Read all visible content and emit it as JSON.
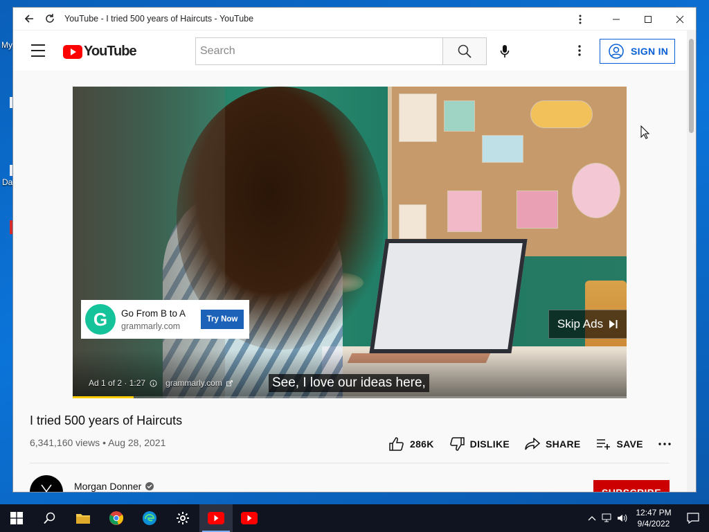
{
  "desktop": {
    "peek_top": "My",
    "peek_mid": "Da"
  },
  "window": {
    "title": "YouTube - I tried 500 years of Haircuts - YouTube"
  },
  "header": {
    "logo_text": "YouTube",
    "search_placeholder": "Search",
    "signin_label": "SIGN IN"
  },
  "video": {
    "caption": "See, I love our ideas here,",
    "ad_info": "Ad 1 of 2 · 1:27",
    "ad_info_domain": "grammarly.com",
    "skip_label": "Skip Ads",
    "progress": 0.11,
    "ad_card": {
      "title": "Go From B to A",
      "domain": "grammarly.com",
      "cta": "Try Now",
      "logo_letter": "G"
    }
  },
  "meta": {
    "title": "I tried 500 years of Haircuts",
    "stats": "6,341,160 views • Aug 28, 2021",
    "like_count": "286K",
    "dislike_label": "DISLIKE",
    "share_label": "SHARE",
    "save_label": "SAVE"
  },
  "channel": {
    "name": "Morgan Donner",
    "subscribe_label": "SUBSCRIBE"
  },
  "taskbar": {
    "time": "12:47 PM",
    "date": "9/4/2022"
  },
  "colors": {
    "yt_red": "#ff0000",
    "link_blue": "#065fd4",
    "taskbar": "#0f1420",
    "grammarly_green": "#15c39a"
  }
}
